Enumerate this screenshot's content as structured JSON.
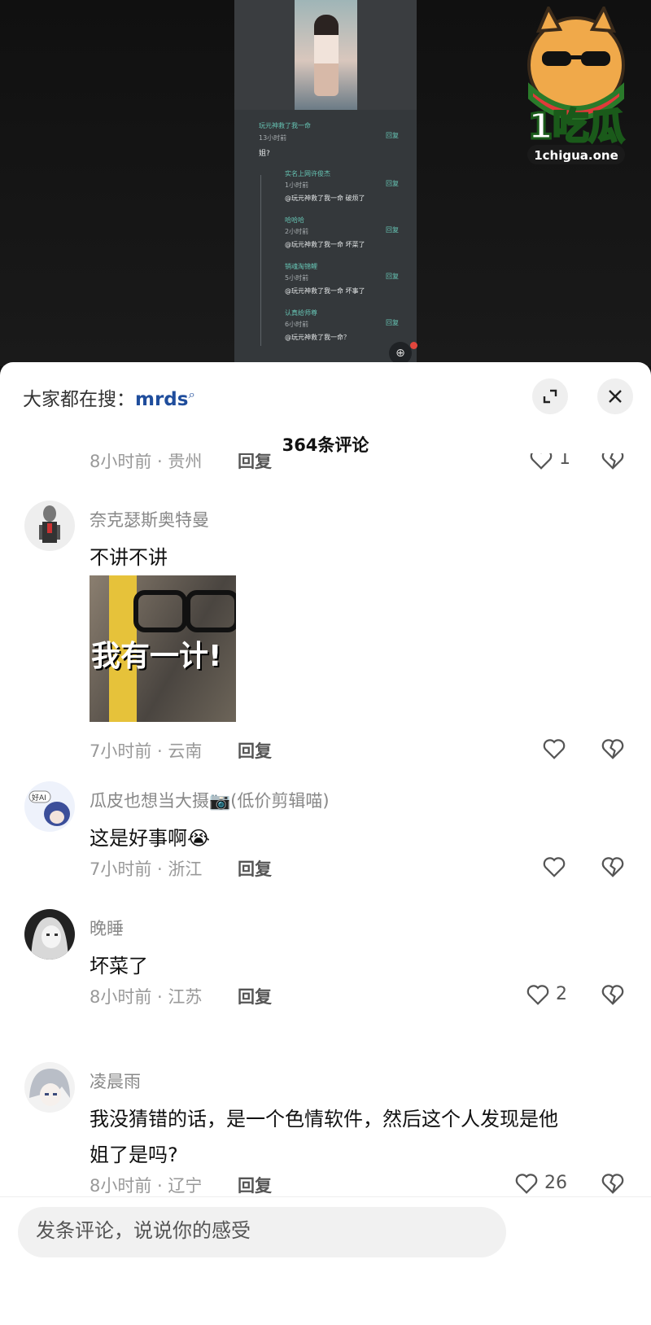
{
  "embedded": {
    "top_comment": {
      "name": "玩元神救了我一命",
      "time": "13小时前",
      "text": "姐?",
      "reply": "回复"
    },
    "replies": [
      {
        "name": "实名上网许俊杰",
        "time": "1小时前",
        "text": "@玩元神救了我一命 破烦了",
        "reply": "回复"
      },
      {
        "name": "哈哈哈",
        "time": "2小时前",
        "text": "@玩元神救了我一命 坏菜了",
        "reply": "回复"
      },
      {
        "name": "销魂淘锦鲤",
        "time": "5小时前",
        "text": "@玩元神救了我一命 坏事了",
        "reply": "回复"
      },
      {
        "name": "认真给师尊",
        "time": "6小时前",
        "text": "@玩元神救了我一命？",
        "reply": "回复"
      }
    ]
  },
  "logo": {
    "brand": "1吃瓜",
    "domain": "1chigua.one"
  },
  "sheet": {
    "search_prefix": "大家都在搜：",
    "search_keyword": "mrds",
    "comment_count": "364条评论"
  },
  "comments": [
    {
      "meta": "8小时前 · 贵州",
      "reply": "回复",
      "likes": "1"
    },
    {
      "name": "奈克瑟斯奥特曼",
      "text": "不讲不讲",
      "sticker_text": "我有一计!",
      "meta": "7小时前 · 云南",
      "reply": "回复",
      "likes": ""
    },
    {
      "name": "瓜皮也想当大摄📷(低价剪辑喵)",
      "text": "这是好事啊😭",
      "avatar_text": "好AI",
      "meta": "7小时前 · 浙江",
      "reply": "回复",
      "likes": ""
    },
    {
      "name": "晚睡",
      "text": "坏菜了",
      "meta": "8小时前 · 江苏",
      "reply": "回复",
      "likes": "2"
    },
    {
      "name": "凌晨雨",
      "text_line1": "我没猜错的话，是一个色情软件，然后这个人发现是他",
      "text_line2": "姐了是吗?",
      "meta": "8小时前 · 辽宁",
      "reply": "回复",
      "likes": "26"
    }
  ],
  "composer": {
    "placeholder": "发条评论，说说你的感受"
  },
  "icons": {
    "expand": "expand-icon",
    "close": "close-icon",
    "like": "heart-icon",
    "dislike": "broken-heart-icon",
    "search": "search-icon"
  }
}
